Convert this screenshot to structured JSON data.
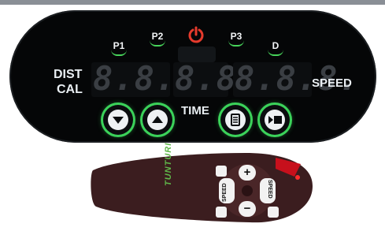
{
  "console": {
    "programs": [
      "P1",
      "P2",
      "P3",
      "D"
    ],
    "left_labels": [
      "DIST",
      "CAL"
    ],
    "right_label": "SPEED",
    "time_label": "TIME",
    "displays": [
      "8.8.8.",
      "8.8.",
      "8.8.8."
    ]
  },
  "icons": {
    "power": "power-icon",
    "down": "arrow-down-icon",
    "up": "arrow-up-icon",
    "program": "program-list-icon",
    "start_stop": "start-stop-icon"
  },
  "remote": {
    "brand": "TUNTURI",
    "speed_left": "SPEED",
    "speed_right": "SPEED",
    "plus": "+",
    "minus": "−"
  },
  "colors": {
    "console_bg": "#050607",
    "accent_green": "#3bd25a",
    "power_red": "#e53a2c",
    "remote_body": "#3b1d1f"
  }
}
